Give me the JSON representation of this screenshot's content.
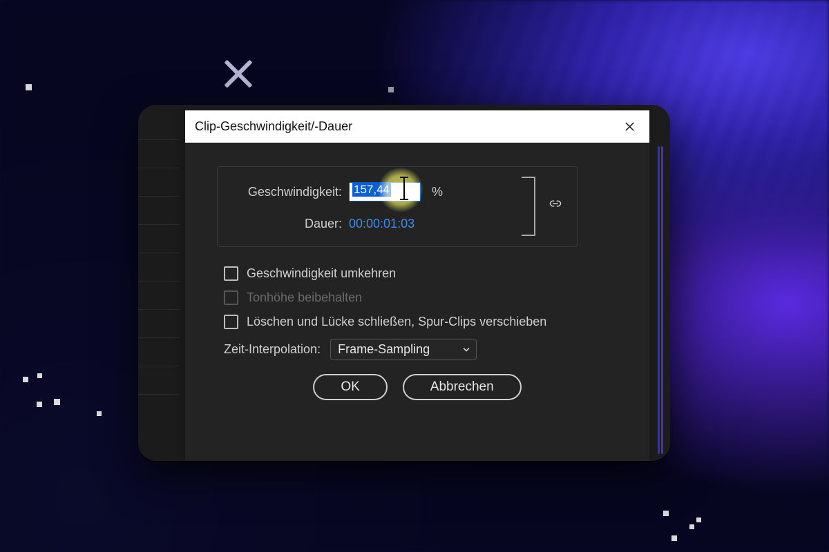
{
  "dialog": {
    "title": "Clip-Geschwindigkeit/-Dauer",
    "speed_label": "Geschwindigkeit:",
    "speed_value": "157,44",
    "speed_unit": "%",
    "duration_label": "Dauer:",
    "duration_value": "00:00:01:03",
    "checks": {
      "reverse": "Geschwindigkeit umkehren",
      "pitch": "Tonhöhe beibehalten",
      "ripple": "Löschen und Lücke schließen, Spur-Clips verschieben"
    },
    "interp_label": "Zeit-Interpolation:",
    "interp_value": "Frame-Sampling",
    "ok": "OK",
    "cancel": "Abbrechen"
  }
}
